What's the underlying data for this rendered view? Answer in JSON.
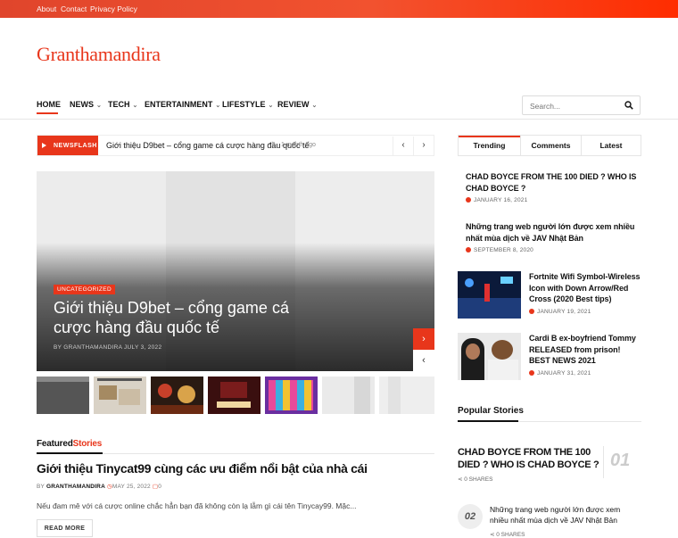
{
  "topbar": {
    "links": [
      "About",
      "Contact",
      "Privacy Policy"
    ]
  },
  "brand": {
    "logo": "Granthamandira",
    "accent": "#e8361b"
  },
  "nav": {
    "items": [
      "HOME",
      "NEWS",
      "TECH",
      "ENTERTAINMENT",
      "LIFESTYLE",
      "REVIEW"
    ]
  },
  "search": {
    "placeholder": "Search..."
  },
  "newsflash": {
    "label": "NEWSFLASH",
    "title": "Giới thiệu D9bet – cổng game cá cược hàng đầu quốc tế",
    "time": "1 month ago"
  },
  "hero": {
    "category": "UNCATEGORIZED",
    "title": "Giới thiệu D9bet – cổng game cá cược hàng đầu quốc tế",
    "by": "BY",
    "author": "GRANTHAMANDIRA",
    "date": "JULY 3, 2022"
  },
  "featured": {
    "heading_a": "Featured",
    "heading_b": "Stories",
    "title": "Giới thiệu Tinycat99 cùng các ưu điểm nổi bật của nhà cái",
    "by": "BY",
    "author": "GRANTHAMANDIRA",
    "date": "MAY 25, 2022",
    "comments": "0",
    "excerpt": "Nếu đam mê với cá cược online chắc hẳn bạn đã không còn lạ lẫm gì cái tên Tinycay99. Mặc...",
    "read_more": "READ MORE"
  },
  "tabs": [
    "Trending",
    "Comments",
    "Latest"
  ],
  "trending": [
    {
      "title": "CHAD BOYCE FROM THE 100 DIED ? WHO IS CHAD BOYCE ?",
      "date": "JANUARY 16, 2021"
    },
    {
      "title": "Những trang web người lớn được xem nhiều nhất mùa dịch về JAV Nhật Bản",
      "date": "SEPTEMBER 8, 2020"
    },
    {
      "title": "Fortnite Wifi Symbol-Wireless Icon with Down Arrow/Red Cross (2020 Best tips)",
      "date": "JANUARY 19, 2021"
    },
    {
      "title": "Cardi B ex-boyfriend Tommy RELEASED from prison! BEST NEWS 2021",
      "date": "JANUARY 31, 2021"
    }
  ],
  "popular": {
    "heading": "Popular Stories",
    "items": [
      {
        "num": "01",
        "title": "CHAD BOYCE FROM THE 100 DIED ? WHO IS CHAD BOYCE ?",
        "shares": "0 SHARES"
      },
      {
        "num": "02",
        "title": "Những trang web người lớn được xem nhiều nhất mùa dịch về JAV Nhật Bản",
        "shares": "0 SHARES"
      }
    ]
  }
}
